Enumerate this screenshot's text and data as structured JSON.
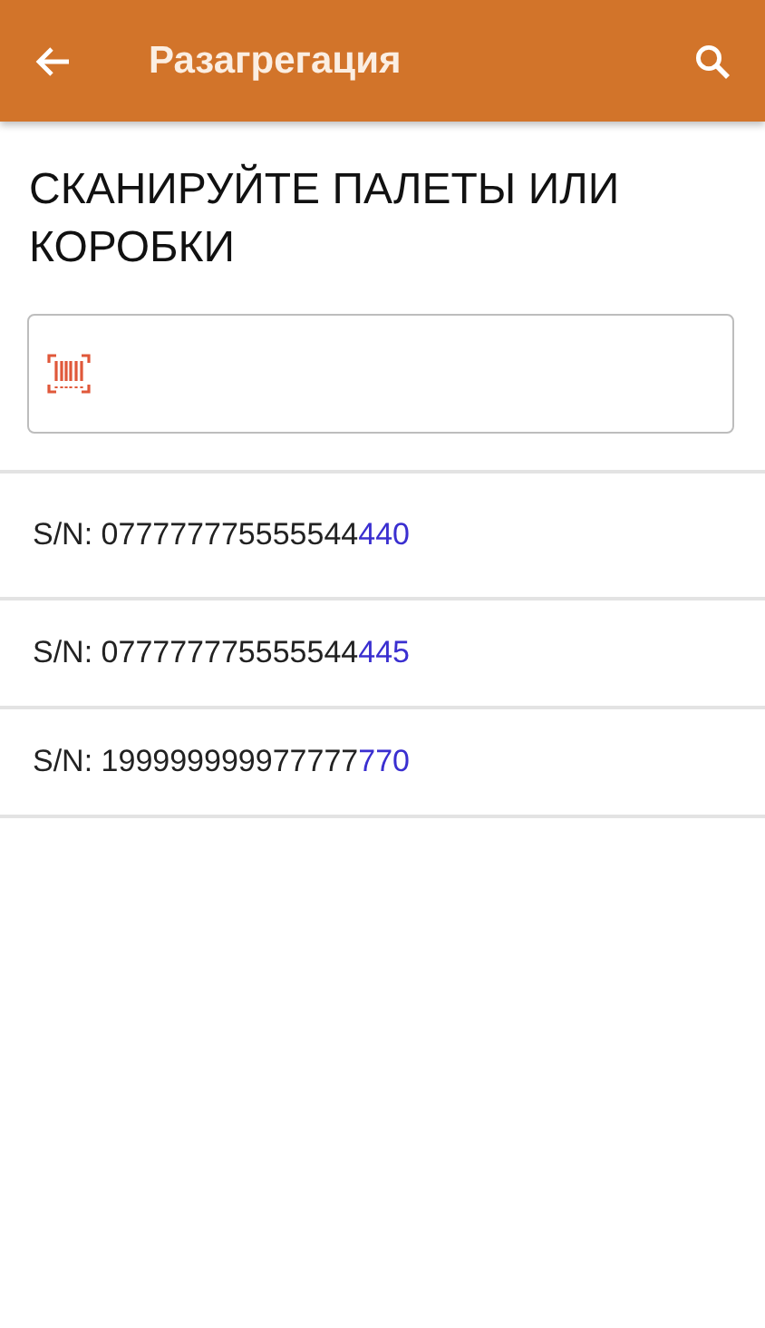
{
  "app_bar": {
    "title": "Разагрегация"
  },
  "prompt": "СКАНИРУЙТЕ ПАЛЕТЫ ИЛИ КОРОБКИ",
  "items": [
    {
      "prefix": "S/N: 077777775555544",
      "suffix": "440"
    },
    {
      "prefix": "S/N: 077777775555544",
      "suffix": "445"
    },
    {
      "prefix": "S/N: 199999999977777",
      "suffix": "770"
    }
  ]
}
